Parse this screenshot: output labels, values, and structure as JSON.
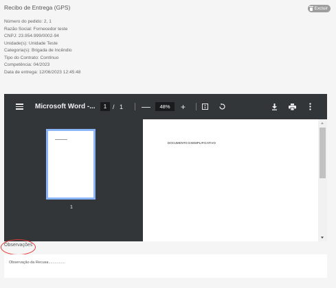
{
  "header": {
    "title": "Recibo de Entrega (GPS)",
    "delete_label": "Excluir"
  },
  "details": [
    "Número do pedido: 2, 1",
    "Razão Social: Fornecedor teste",
    "CNPJ: 23.954.999/0002-94",
    "Unidade(s): Unidade Teste",
    "Categoria(s): Brigada de Incêndio",
    "Tipo do Contrato: Contínuo",
    "Competência: 04/2023",
    "Data de entrega: 12/06/2023 12:45:48"
  ],
  "viewer": {
    "doc_title": "Microsoft Word -...",
    "current_page": "1",
    "page_separator": "/",
    "total_pages": "1",
    "zoom_out": "—",
    "zoom": "48%",
    "zoom_in": "+",
    "thumbnail_number": "1",
    "page_heading": "DOCUMENTO EXEMPLIFICATIVO",
    "icons": [
      "menu-icon",
      "fit-page-icon",
      "rotate-icon",
      "download-icon",
      "print-icon",
      "more-vert-icon"
    ]
  },
  "observacoes": {
    "label": "Observações",
    "text": "Observação da Recusa................"
  },
  "colors": {
    "toolbar": "#323639",
    "viewer_bg": "#525659",
    "thumb_border": "#8ab4f8",
    "highlight_circle": "#e53935"
  }
}
